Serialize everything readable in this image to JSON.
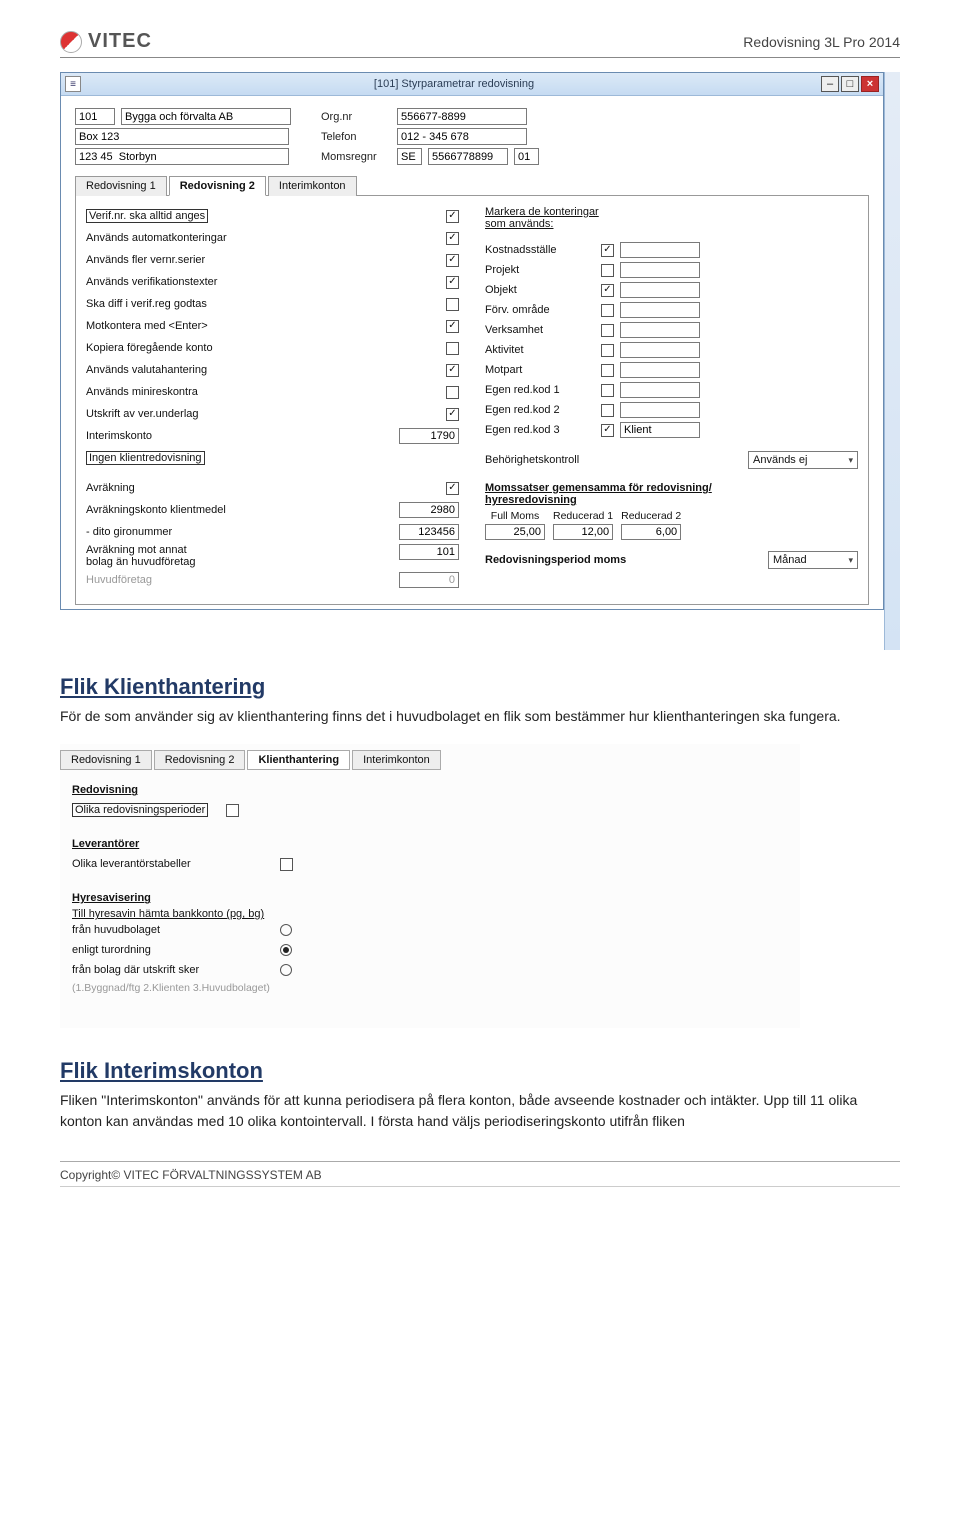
{
  "header": {
    "logo_text": "VITEC",
    "doc_title": "Redovisning 3L Pro 2014"
  },
  "window1": {
    "title": "[101]  Styrparametrar redovisning",
    "icon_hint": "document-icon",
    "company": {
      "code": "101",
      "name": "Bygga och förvalta AB",
      "address1": "Box 123",
      "address2": "123 45  Storbyn",
      "orgnr_label": "Org.nr",
      "orgnr": "556677-8899",
      "tel_label": "Telefon",
      "tel": "012 - 345 678",
      "momsreg_label": "Momsregnr",
      "momsreg_prefix": "SE",
      "momsreg": "5566778899",
      "momsreg_suffix": "01"
    },
    "tabs": [
      "Redovisning 1",
      "Redovisning 2",
      "Interimkonton"
    ],
    "active_tab": "Redovisning 2",
    "left": {
      "rows": [
        {
          "label": "Verif.nr. ska alltid anges",
          "checked": true,
          "boxed": true
        },
        {
          "label": "Används automatkonteringar",
          "checked": true
        },
        {
          "label": "Används fler vernr.serier",
          "checked": true
        },
        {
          "label": "Används verifikationstexter",
          "checked": true
        },
        {
          "label": "Ska diff i verif.reg godtas",
          "checked": false
        },
        {
          "label": "Motkontera med <Enter>",
          "checked": true
        },
        {
          "label": "Kopiera föregående konto",
          "checked": false
        },
        {
          "label": "Används valutahantering",
          "checked": true
        },
        {
          "label": "Används minireskontra",
          "checked": false
        },
        {
          "label": "Utskrift av ver.underlag",
          "checked": true
        }
      ],
      "interimskonto_label": "Interimskonto",
      "interimskonto_value": "1790",
      "klientred_label": "Ingen klientredovisning",
      "avrakning_label": "Avräkning",
      "avrakning_checked": true,
      "avrkonto_label": "Avräkningskonto klientmedel",
      "avrkonto_value": "2980",
      "giro_label": "- dito gironummer",
      "giro_value": "123456",
      "avrann_label": "Avräkning mot annat\nbolag än huvudföretag",
      "avrann_value": "101",
      "huvud_label": "Huvudföretag",
      "huvud_value": "0"
    },
    "right": {
      "header": "Markera de konteringar\nsom används:",
      "rows": [
        {
          "label": "Kostnadsställe",
          "checked": true,
          "input": ""
        },
        {
          "label": "Projekt",
          "checked": false,
          "input": ""
        },
        {
          "label": "Objekt",
          "checked": true,
          "input": ""
        },
        {
          "label": "Förv. område",
          "checked": false,
          "input": ""
        },
        {
          "label": "Verksamhet",
          "checked": false,
          "input": ""
        },
        {
          "label": "Aktivitet",
          "checked": false,
          "input": ""
        },
        {
          "label": "Motpart",
          "checked": false,
          "input": ""
        },
        {
          "label": "Egen red.kod 1",
          "checked": false,
          "input": ""
        },
        {
          "label": "Egen red.kod 2",
          "checked": false,
          "input": ""
        },
        {
          "label": "Egen red.kod 3",
          "checked": true,
          "input": "Klient"
        }
      ],
      "behorighet_label": "Behörighetskontroll",
      "behorighet_value": "Används ej",
      "moms_header": "Momssatser gemensamma för redovisning/\nhyresredovisning",
      "moms_cols": [
        "Full Moms",
        "Reducerad 1",
        "Reducerad 2"
      ],
      "moms_vals": [
        "25,00",
        "12,00",
        "6,00"
      ],
      "period_label": "Redovisningsperiod moms",
      "period_value": "Månad"
    }
  },
  "section1": {
    "heading": "Flik Klienthantering",
    "body": "För de som använder sig av klienthantering finns det i huvudbolaget en flik som bestämmer hur klienthanteringen ska fungera."
  },
  "panel2": {
    "tabs": [
      "Redovisning 1",
      "Redovisning 2",
      "Klienthantering",
      "Interimkonton"
    ],
    "active_tab": "Klienthantering",
    "groups": [
      {
        "title": "Redovisning",
        "items": [
          {
            "label": "Olika redovisningsperioder",
            "type": "checkbox",
            "checked": false,
            "boxed": true
          }
        ]
      },
      {
        "title": "Leverantörer",
        "items": [
          {
            "label": "Olika leverantörstabeller",
            "type": "checkbox",
            "checked": false
          }
        ]
      },
      {
        "title": "Hyresavisering",
        "subtitle": "Till hyresavin hämta bankkonto (pg, bg)",
        "items": [
          {
            "label": "från huvudbolaget",
            "type": "radio",
            "checked": false
          },
          {
            "label": "enligt turordning",
            "type": "radio",
            "checked": true
          },
          {
            "label": "från bolag där utskrift sker",
            "type": "radio",
            "checked": false
          }
        ],
        "note": "(1.Byggnad/ftg  2.Klienten  3.Huvudbolaget)"
      }
    ]
  },
  "section2": {
    "heading": "Flik Interimskonton",
    "body": "Fliken \"Interimskonton\" används för att kunna periodisera på flera konton, både avseende kostnader och intäkter. Upp till 11 olika konton kan användas med 10 olika kontointervall. I första hand väljs periodiseringskonto utifrån fliken"
  },
  "footer": {
    "text_prefix": "Copyright© V",
    "text_smallcaps": "ITEC",
    "text_mid": " F",
    "text_smallcaps2": "ÖRVALTNINGSSYSTEM",
    "text_suffix": " AB"
  }
}
